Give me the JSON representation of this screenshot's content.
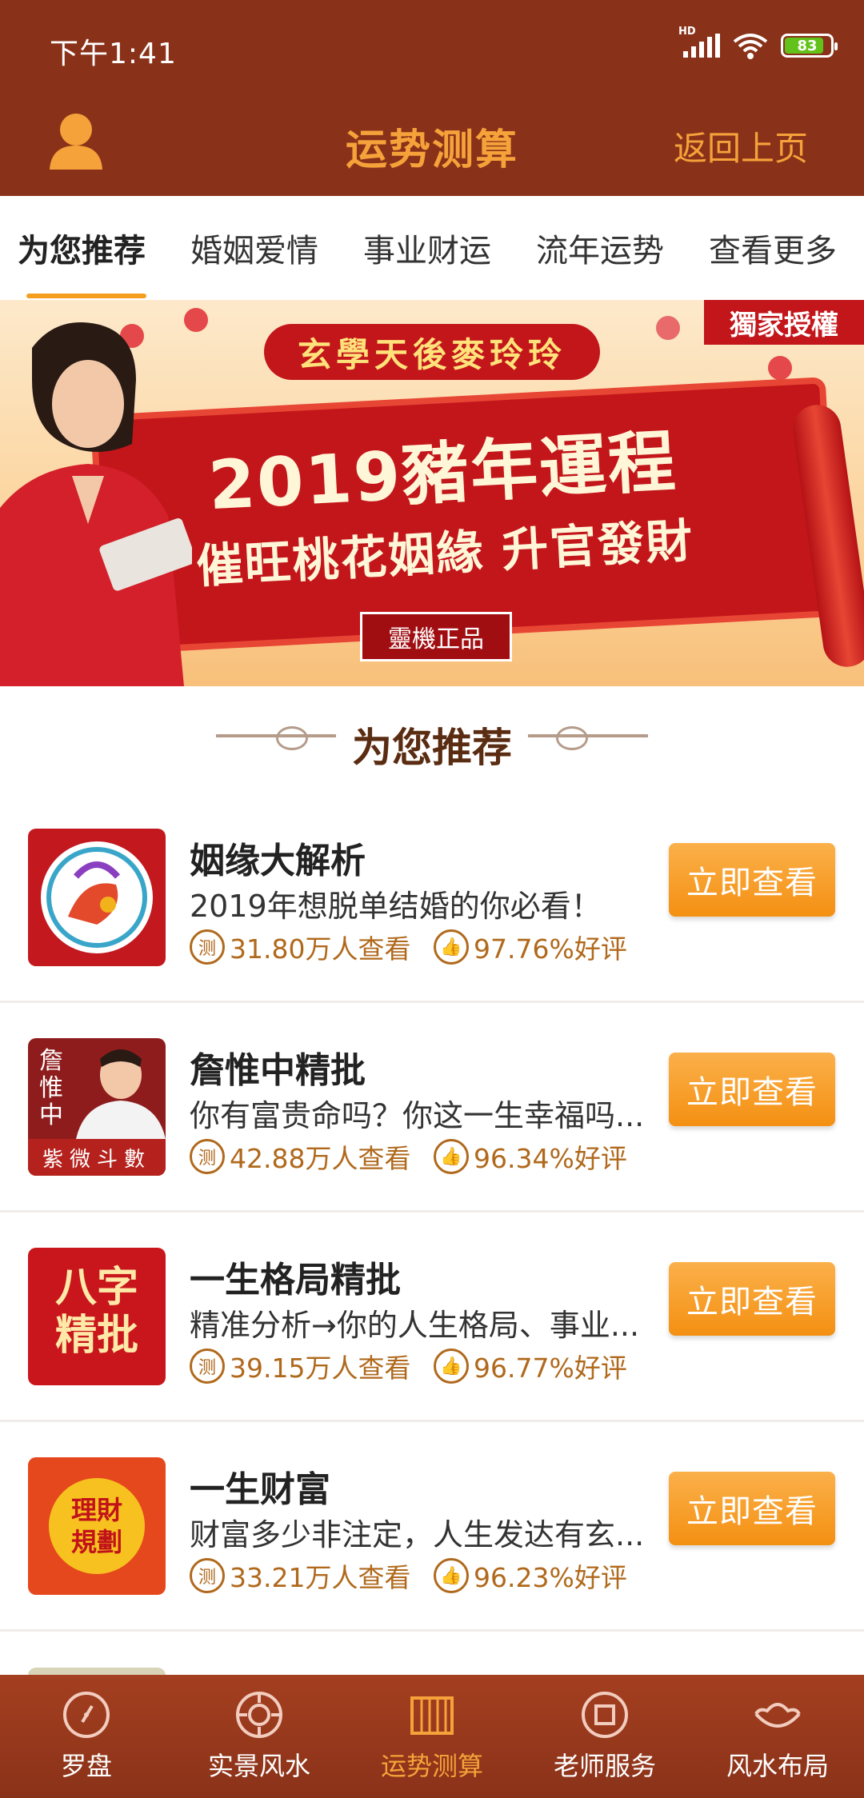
{
  "status": {
    "time": "下午1:41",
    "battery": "83",
    "network": "HD"
  },
  "header": {
    "title": "运势测算",
    "back_label": "返回上页"
  },
  "tabs": [
    "为您推荐",
    "婚姻爱情",
    "事业财运",
    "流年运势",
    "查看更多"
  ],
  "banner": {
    "top_text": "玄學天後麥玲玲",
    "tag": "獨家授權",
    "headline": "2019豬年運程",
    "subline": "催旺桃花姻緣 升官發財",
    "seal": "靈機正品"
  },
  "section_title": "为您推荐",
  "items": [
    {
      "title": "姻缘大解析",
      "desc": "2019年想脱单结婚的你必看！",
      "views": "31.80万人查看",
      "rating": "97.76%好评",
      "cta": "立即查看"
    },
    {
      "title": "詹惟中精批",
      "desc": "你有富贵命吗？你这一生幸福吗...",
      "views": "42.88万人查看",
      "rating": "96.34%好评",
      "cta": "立即查看",
      "thumb_text": "詹惟中",
      "thumb_sub": "紫微斗數"
    },
    {
      "title": "一生格局精批",
      "desc": "精准分析→你的人生格局、事业...",
      "views": "39.15万人查看",
      "rating": "96.77%好评",
      "cta": "立即查看",
      "thumb_text": "八字精批"
    },
    {
      "title": "一生财富",
      "desc": "财富多少非注定，人生发达有玄...",
      "views": "33.21万人查看",
      "rating": "96.23%好评",
      "cta": "立即查看",
      "thumb_text": "理財規劃"
    }
  ],
  "meta_icon_text": "测",
  "bottom_nav": [
    "罗盘",
    "实景风水",
    "运势测算",
    "老师服务",
    "风水布局"
  ]
}
